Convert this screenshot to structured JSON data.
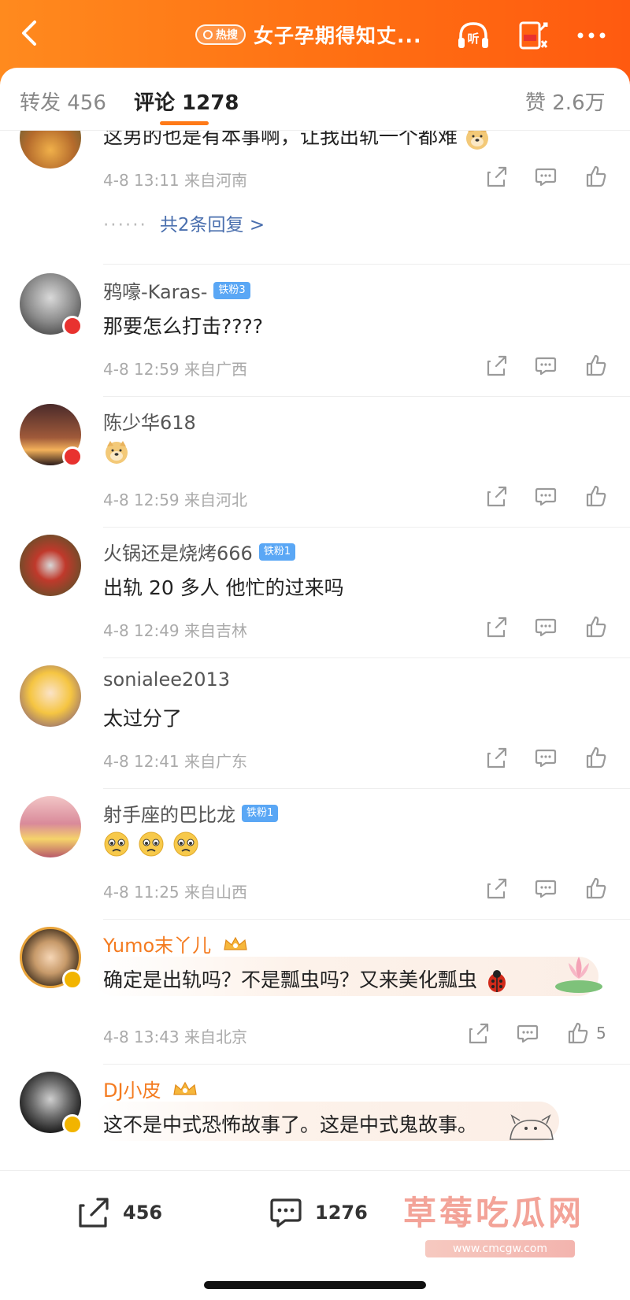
{
  "header": {
    "hot_tag": "热搜",
    "title": "女子孕期得知丈...",
    "listen_label": "听"
  },
  "tabs": {
    "repost": "转发 456",
    "comment": "评论 1278",
    "like": "赞 2.6万"
  },
  "comments": [
    {
      "name": "",
      "text": "这男的也是有本事啊，让我出轨一个都难",
      "time": "4-8 13:11 来自河南",
      "replies": "共2条回复 >",
      "replies_dots": "······"
    },
    {
      "name": "鸦嚎-Karas-",
      "badge": "铁粉3",
      "text": "那要怎么打击????",
      "time": "4-8 12:59 来自广西"
    },
    {
      "name": "陈少华618",
      "text": "",
      "time": "4-8 12:59 来自河北"
    },
    {
      "name": "火锅还是烧烤666",
      "badge": "铁粉1",
      "text": "出轨 20 多人 他忙的过来吗",
      "time": "4-8 12:49 来自吉林"
    },
    {
      "name": "sonialee2013",
      "text": "太过分了",
      "time": "4-8 12:41 来自广东"
    },
    {
      "name": "射手座的巴比龙",
      "badge": "铁粉1",
      "text": "",
      "time": "4-8 11:25 来自山西"
    },
    {
      "name": "Yumo末丫儿",
      "text": "确定是出轨吗？不是瓢虫吗？又来美化瓢虫",
      "time": "4-8 13:43 来自北京",
      "likes": "5"
    },
    {
      "name": "DJ小皮",
      "text": "这不是中式恐怖故事了。这是中式鬼故事。"
    }
  ],
  "bottom_bar": {
    "repost_count": "456",
    "comment_count": "1276"
  },
  "watermark": {
    "text": "草莓吃瓜网",
    "url": "www.cmcgw.com"
  },
  "colors": {
    "header_orange": "#ff7a18",
    "vip_name": "#f47b20",
    "reply_link": "#4a6fae",
    "fan_badge": "#5aa7f5"
  }
}
